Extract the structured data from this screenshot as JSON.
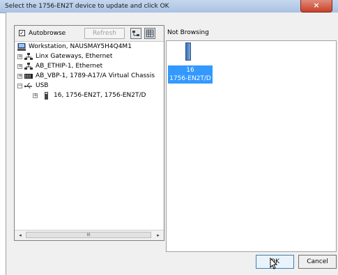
{
  "window": {
    "title": "Select the 1756-EN2T device to update and click OK",
    "close_glyph": "×"
  },
  "toolbar": {
    "autobrowse_label": "Autobrowse",
    "autobrowse_checked": true,
    "refresh_label": "Refresh",
    "view_icons": [
      "browse-view-icon",
      "grid-view-icon"
    ]
  },
  "tree": {
    "root": "Workstation, NAUSMAY5H4Q4M1",
    "items": [
      {
        "label": "Linx Gateways, Ethernet",
        "icon": "network-icon",
        "expander": "+"
      },
      {
        "label": "AB_ETHIP-1, Ethernet",
        "icon": "network-icon",
        "expander": "+"
      },
      {
        "label": "AB_VBP-1, 1789-A17/A Virtual Chassis",
        "icon": "chassis-icon",
        "expander": "+"
      },
      {
        "label": "USB",
        "icon": "usb-icon",
        "expander": "−"
      },
      {
        "label": "16, 1756-EN2T, 1756-EN2T/D",
        "icon": "module-icon",
        "expander": "+"
      }
    ]
  },
  "right": {
    "status": "Not Browsing",
    "device": {
      "line1": "16",
      "line2": "1756-EN2T/D"
    }
  },
  "scrollbar": {
    "left_arrow": "◂",
    "right_arrow": "▸",
    "thumb_grip": "III"
  },
  "buttons": {
    "ok": "OK",
    "cancel": "Cancel"
  },
  "colors": {
    "selection": "#3399ff",
    "title_bar": "#b9cde8",
    "close_button": "#c7422a"
  }
}
